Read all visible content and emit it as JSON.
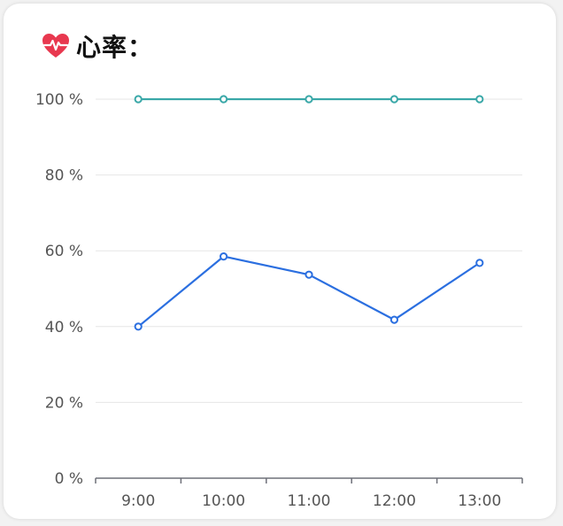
{
  "card": {
    "title": "心率：",
    "icon": "heart-pulse-icon",
    "icon_color": "#e8384f"
  },
  "chart_data": {
    "type": "line",
    "title": "",
    "xlabel": "",
    "ylabel": "",
    "categories": [
      "9:00",
      "10:00",
      "11:00",
      "12:00",
      "13:00"
    ],
    "y_ticks": [
      "0 %",
      "20 %",
      "40 %",
      "60 %",
      "80 %",
      "100 %"
    ],
    "ylim": [
      0,
      100
    ],
    "grid": true,
    "series": [
      {
        "values": [
          100,
          100,
          100,
          100,
          100
        ],
        "color": "#3aa8a8"
      },
      {
        "values": [
          40,
          58.5,
          53.7,
          41.8,
          56.8
        ],
        "color": "#2b6fe0"
      }
    ]
  }
}
